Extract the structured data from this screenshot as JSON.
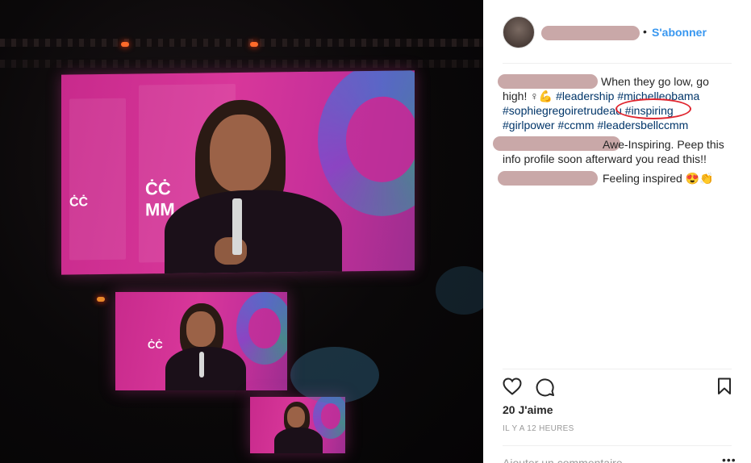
{
  "post": {
    "follow_label": "S'abonner",
    "dot": "•",
    "caption": {
      "text": "When they go low, go high! ♀💪",
      "tags_line1": "#leadership #michelleobama",
      "tags_line2": "#sophiegregoiretrudeau",
      "tag_highlight": "#inspiring",
      "tags_line3": "#girlpower #ccmm #leadersbellccmm"
    },
    "comments": [
      {
        "text_line1": "Awe-Inspiring. Peep this",
        "text_line2": "info profile soon afterward you read this!!"
      },
      {
        "text": "Feeling inspired 😍👏"
      }
    ],
    "likes": "20 J'aime",
    "timestamp": "IL Y A 12 HEURES",
    "add_comment_placeholder": "Ajouter un commentaire...",
    "more_label": "•••",
    "icons": {
      "like": "heart-icon",
      "comment": "comment-icon",
      "save": "bookmark-icon"
    },
    "colors": {
      "link": "#3897f0",
      "hashtag": "#003569",
      "annotation": "#e0262f",
      "redaction": "#c9a8a8"
    }
  }
}
